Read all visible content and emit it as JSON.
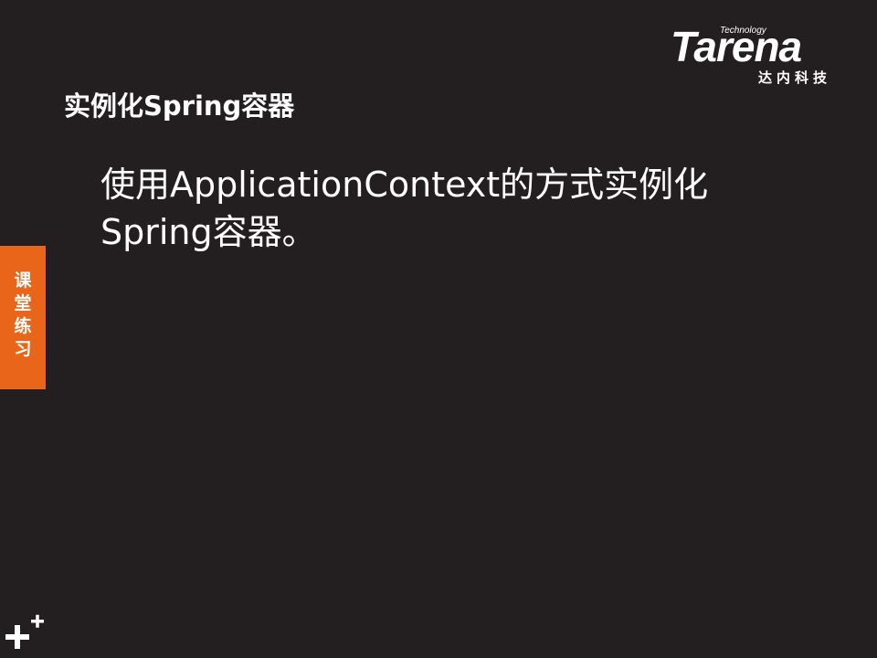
{
  "slide": {
    "title": "实例化Spring容器",
    "body": "使用ApplicationContext的方式实例化Spring容器。",
    "side_tab_label": "课\n堂\n练\n习"
  },
  "logo": {
    "tech": "Technology",
    "brand": "Tarena",
    "chinese": "达内科技"
  },
  "colors": {
    "background": "#231f20",
    "accent": "#e8651a",
    "text": "#ffffff"
  },
  "icons": {
    "corner": "plus-plus-icon"
  }
}
